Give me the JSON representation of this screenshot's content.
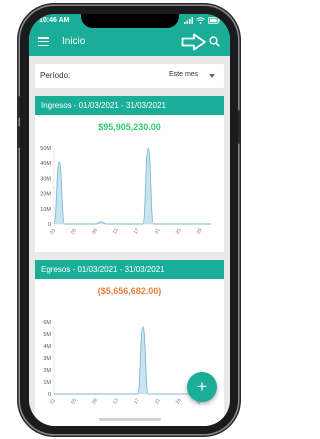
{
  "status_bar": {
    "time": "10:46 AM",
    "icons": [
      "signal-icon",
      "wifi-icon",
      "battery-icon"
    ]
  },
  "app_bar": {
    "title": "Inicio",
    "icons": [
      "menu-icon",
      "arrow-icon",
      "search-icon"
    ]
  },
  "filter": {
    "label": "Período:",
    "selected": "Este mes"
  },
  "ingresos": {
    "title": "Ingresos - 01/03/2021 - 31/03/2021",
    "total": "$95,905,230.00",
    "chart_data": {
      "type": "area",
      "y_ticks": [
        "0",
        "10M",
        "20M",
        "30M",
        "40M",
        "50M"
      ],
      "x_ticks": [
        "01",
        "05",
        "09",
        "13",
        "17",
        "21",
        "25",
        "29"
      ],
      "ylim": [
        0,
        50000000
      ],
      "x": [
        1,
        2,
        3,
        4,
        5,
        6,
        7,
        8,
        9,
        10,
        11,
        12,
        13,
        14,
        15,
        16,
        17,
        18,
        19,
        20,
        21,
        22,
        23,
        24,
        25,
        26,
        27,
        28,
        29,
        30,
        31
      ],
      "values": [
        0,
        41000000,
        0,
        0,
        0,
        0,
        0,
        0,
        0,
        1500000,
        0,
        0,
        0,
        0,
        0,
        0,
        0,
        0,
        50000000,
        0,
        0,
        0,
        0,
        0,
        0,
        0,
        0,
        0,
        0,
        0,
        0
      ]
    }
  },
  "egresos": {
    "title": "Egresos - 01/03/2021 - 31/03/2021",
    "total": "($5,656,682.00)",
    "chart_data": {
      "type": "area",
      "y_ticks": [
        "0",
        "1M",
        "2M",
        "3M",
        "4M",
        "5M",
        "6M"
      ],
      "x_ticks": [
        "01",
        "05",
        "09",
        "13",
        "17",
        "21",
        "25",
        "29"
      ],
      "ylim": [
        0,
        6000000
      ],
      "x": [
        1,
        2,
        3,
        4,
        5,
        6,
        7,
        8,
        9,
        10,
        11,
        12,
        13,
        14,
        15,
        16,
        17,
        18,
        19,
        20,
        21,
        22,
        23,
        24,
        25,
        26,
        27,
        28,
        29,
        30,
        31
      ],
      "values": [
        0,
        0,
        0,
        0,
        0,
        0,
        0,
        0,
        0,
        0,
        0,
        0,
        0,
        0,
        0,
        0,
        0,
        5600000,
        0,
        0,
        0,
        0,
        0,
        0,
        0,
        0,
        0,
        0,
        0,
        0,
        0
      ]
    }
  },
  "fab": {
    "label": "+"
  },
  "colors": {
    "primary": "#1aae99",
    "income": "#2ecc71",
    "expense": "#e67e3e",
    "chart_fill": "#b7dbe8",
    "chart_line": "#7ab9d1"
  }
}
